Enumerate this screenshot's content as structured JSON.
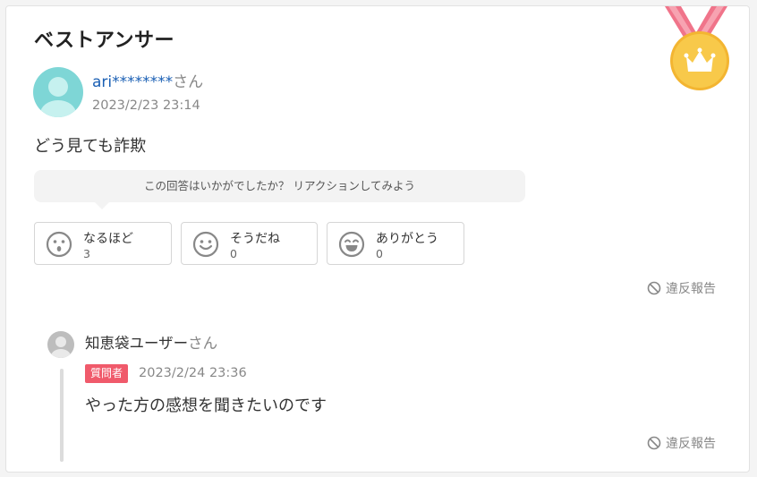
{
  "section": {
    "title": "ベストアンサー"
  },
  "answer": {
    "user_name": "ari********",
    "user_suffix": "さん",
    "timestamp": "2023/2/23 23:14",
    "body": "どう見ても詐欺"
  },
  "reaction": {
    "prompt": "この回答はいかがでしたか？ リアクションしてみよう",
    "buttons": [
      {
        "label": "なるほど",
        "count": "3",
        "icon": "surprised-face-icon"
      },
      {
        "label": "そうだね",
        "count": "0",
        "icon": "smile-face-icon"
      },
      {
        "label": "ありがとう",
        "count": "0",
        "icon": "happy-face-icon"
      }
    ]
  },
  "report_label": "違反報告",
  "reply": {
    "user_name": "知恵袋ユーザー",
    "user_suffix": "さん",
    "badge": "質問者",
    "timestamp": "2023/2/24 23:36",
    "body": "やった方の感想を聞きたいのです"
  },
  "colors": {
    "link": "#1a5fb4",
    "badge": "#f05a6b",
    "medal_gold": "#f8c94a",
    "ribbon": "#f0748a",
    "avatar_teal": "#7ed6d6"
  }
}
